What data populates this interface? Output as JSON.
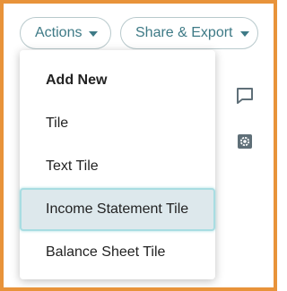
{
  "toolbar": {
    "actions_label": "Actions",
    "share_export_label": "Share & Export"
  },
  "menu": {
    "items": [
      {
        "label": "Add New",
        "type": "header"
      },
      {
        "label": "Tile"
      },
      {
        "label": "Text Tile"
      },
      {
        "label": "Income Statement Tile",
        "state": "highlighted"
      },
      {
        "label": "Balance Sheet Tile"
      }
    ]
  },
  "side_icons": [
    "comment-icon",
    "settings-icon"
  ],
  "colors": {
    "frame_border": "#e8933a",
    "accent_text": "#3e7a86",
    "highlight_bg": "#dde8ec",
    "highlight_border": "#a8dde2"
  }
}
